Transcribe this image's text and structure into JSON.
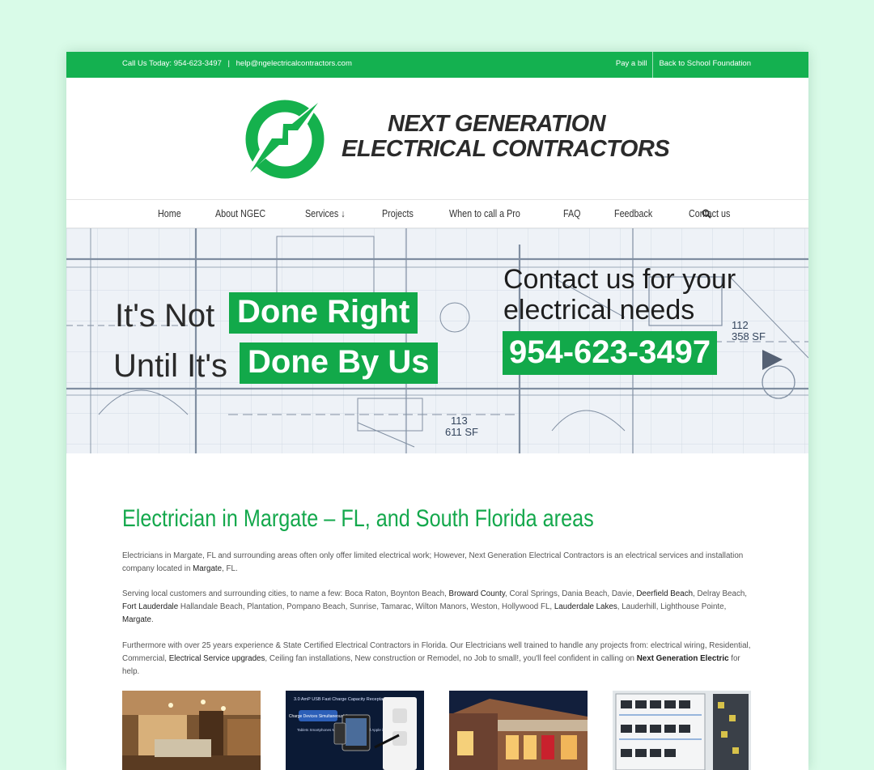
{
  "topbar": {
    "call_text": "Call Us Today: 954-623-3497",
    "separator": "|",
    "email": "help@ngelectricalcontractors.com",
    "links": [
      "Pay a bill",
      "Back to School Foundation"
    ]
  },
  "logo": {
    "line1": "NEXT GENERATION",
    "line2": "ELECTRICAL CONTRACTORS"
  },
  "nav": {
    "items": [
      "Home",
      "About NGEC",
      "Services ↓",
      "Projects",
      "When to call a Pro",
      "FAQ",
      "Feedback",
      "Contact us"
    ]
  },
  "hero": {
    "line1_prefix": "It's Not",
    "line1_box": "Done Right",
    "line2_prefix": "Until It's",
    "line2_box": "Done By Us",
    "contact_line1": "Contact us for your",
    "contact_line2": "electrical needs",
    "phone": "954-623-3497",
    "plan_labels": [
      "113",
      "611 SF",
      "112",
      "358 SF"
    ]
  },
  "content": {
    "title": "Electrician in Margate – FL, and South Florida areas",
    "p1_a": "Electricians in Margate, FL and surrounding areas often only offer limited electrical work; However, Next Generation Electrical Contractors is an electrical services and installation company located in ",
    "p1_link": "Margate",
    "p1_b": ", FL.",
    "p2_a": "Serving local customers and surrounding cities, to name a few: Boca Raton, Boynton Beach, ",
    "p2_l1": "Broward County",
    "p2_b": ", Coral Springs, Dania Beach, Davie, ",
    "p2_l2": "Deerfield Beach",
    "p2_c": ", Delray Beach, ",
    "p2_l3": "Fort Lauderdale",
    "p2_d": " Hallandale Beach, Plantation, Pompano Beach, Sunrise, Tamarac, Wilton Manors, Weston, Hollywood FL, ",
    "p2_l4": "Lauderdale Lakes",
    "p2_e": ", Lauderhill, Lighthouse Pointe, ",
    "p2_l5": "Margate",
    "p2_f": ".",
    "p3_a": "Furthermore with over 25 years experience & State Certified Electrical Contractors in Florida. Our Electricians well trained to handle any projects from: electrical wiring, Residential, Commercial, ",
    "p3_l1": "Electrical Service upgrades",
    "p3_b": ", Ceiling fan installations, New construction or Remodel, no Job to small!, you'll feel confident in calling on ",
    "p3_l2": "Next Generation Electric",
    "p3_c": " for help."
  },
  "thumb_text": {
    "usb_header": "3.0 AmP USB Fast Charge Capacity Receptacle",
    "usb_badge": "Charge Devices Simultaneously!",
    "usb_devices": "Tablets Smartphones MP3 players Apple iPad Apple iPhone"
  },
  "colors": {
    "accent": "#14b150",
    "page_bg": "#d9fbe8",
    "title_green": "#14a84c"
  }
}
